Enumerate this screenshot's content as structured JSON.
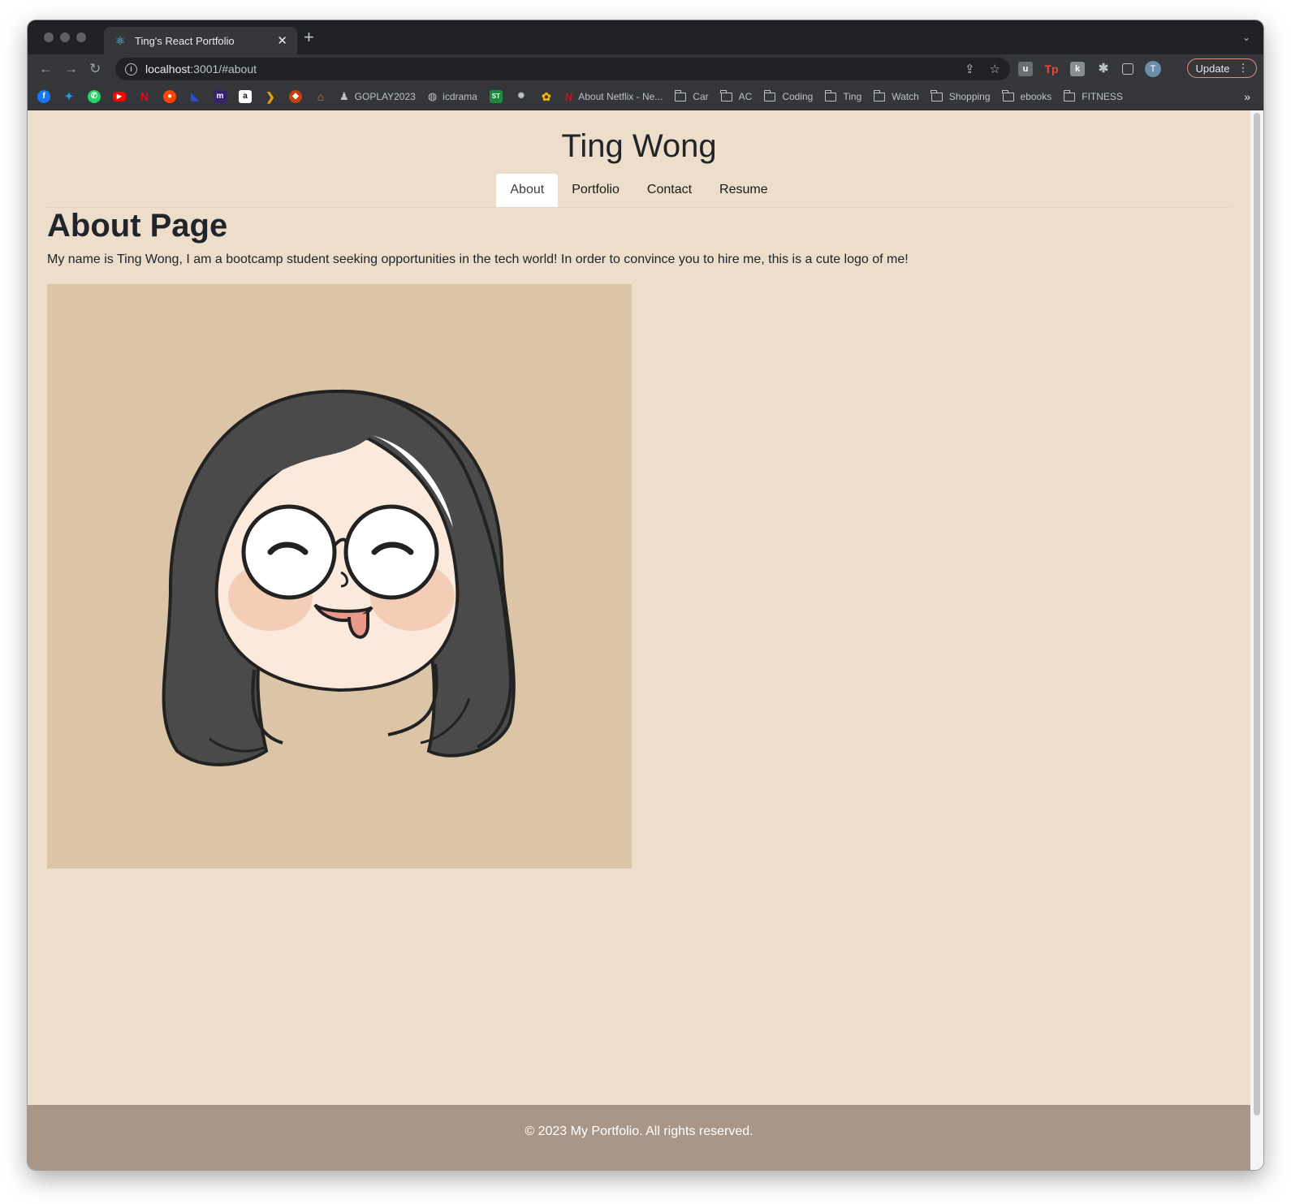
{
  "browser": {
    "tab_title": "Ting's React Portfolio",
    "url_host": "localhost",
    "url_rest": ":3001/#about",
    "update_label": "Update",
    "profile_initial": "T",
    "bookmarks": [
      {
        "label": "GOPLAY2023"
      },
      {
        "label": "icdrama"
      },
      {
        "label": "About Netflix - Ne..."
      }
    ],
    "folders": [
      "Car",
      "AC",
      "Coding",
      "Ting",
      "Watch",
      "Shopping",
      "ebooks",
      "FITNESS"
    ]
  },
  "site": {
    "title": "Ting Wong",
    "nav": [
      "About",
      "Portfolio",
      "Contact",
      "Resume"
    ],
    "active_nav": "About"
  },
  "about": {
    "heading": "About Page",
    "text": "My name is Ting Wong, I am a bootcamp student seeking opportunities in the tech world! In order to convince you to hire me, this is a cute logo of me!"
  },
  "footer": {
    "text": "© 2023 My Portfolio. All rights reserved."
  },
  "colors": {
    "page_bg": "#ecdeca",
    "footer_bg": "#a89789",
    "avatar_bg": "#dcc5a6",
    "hair": "#4a4a4a",
    "skin": "#fbeadb",
    "blush": "#f3cdb5"
  }
}
